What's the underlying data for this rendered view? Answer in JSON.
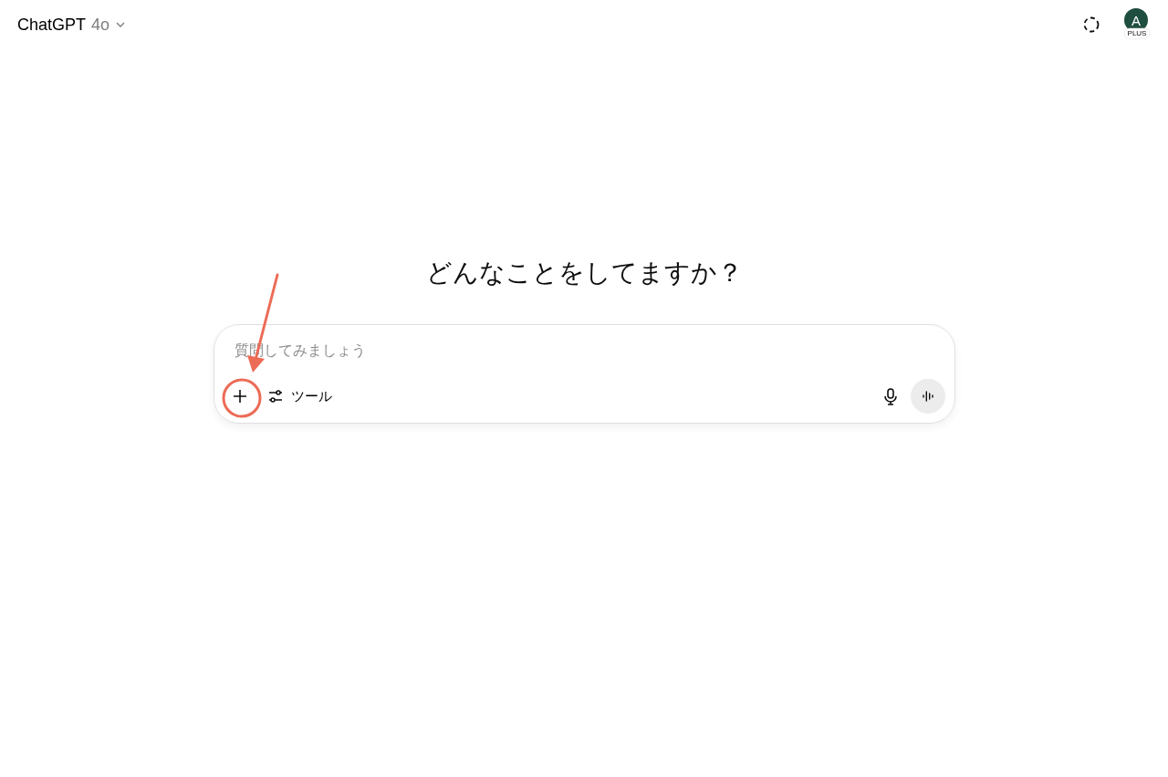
{
  "header": {
    "model_name": "ChatGPT",
    "model_version": "4o",
    "avatar_letter": "A",
    "plan_badge": "PLUS"
  },
  "heading": "どんなことをしてますか？",
  "composer": {
    "placeholder": "質問してみましょう",
    "tools_label": "ツール"
  }
}
